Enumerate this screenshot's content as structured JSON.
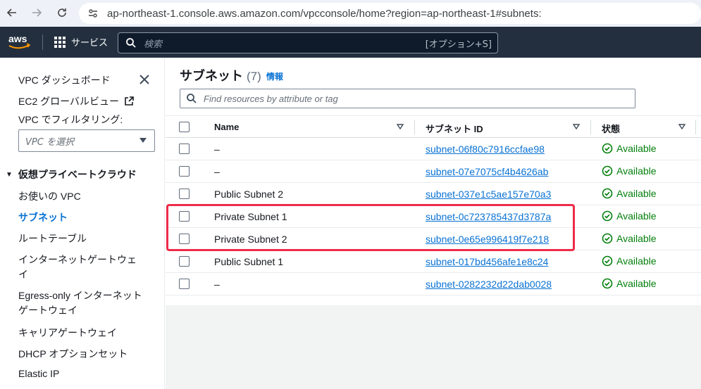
{
  "browser": {
    "url": "ap-northeast-1.console.aws.amazon.com/vpcconsole/home?region=ap-northeast-1#subnets:"
  },
  "aws_nav": {
    "logo_text": "aws",
    "services_label": "サービス",
    "search_placeholder": "検索",
    "search_shortcut": "[オプション+S]"
  },
  "sidebar": {
    "dashboard": "VPC ダッシュボード",
    "ec2_global_view": "EC2 グローバルビュー",
    "filter_label": "VPC でフィルタリング:",
    "vpc_select_placeholder": "VPC を選択",
    "section_title": "仮想プライベートクラウド",
    "items": [
      {
        "label": "お使いの VPC",
        "active": false
      },
      {
        "label": "サブネット",
        "active": true
      },
      {
        "label": "ルートテーブル",
        "active": false
      },
      {
        "label": "インターネットゲートウェ",
        "label2": "イ",
        "active": false
      },
      {
        "label": "Egress-only インターネット",
        "label2": "ゲートウェイ",
        "active": false
      },
      {
        "label": "キャリアゲートウェイ",
        "active": false
      },
      {
        "label": "DHCP オプションセット",
        "active": false
      },
      {
        "label": "Elastic IP",
        "active": false
      }
    ]
  },
  "main": {
    "title": "サブネット",
    "count": "(7)",
    "info": "情報",
    "filter_placeholder": "Find resources by attribute or tag",
    "columns": {
      "name": "Name",
      "subnet_id": "サブネット ID",
      "state": "状態"
    },
    "rows": [
      {
        "name": "–",
        "subnet_id": "subnet-06f80c7916ccfae98",
        "state": "Available"
      },
      {
        "name": "–",
        "subnet_id": "subnet-07e7075cf4b4626ab",
        "state": "Available"
      },
      {
        "name": "Public Subnet 2",
        "subnet_id": "subnet-037e1c5ae157e70a3",
        "state": "Available"
      },
      {
        "name": "Private Subnet 1",
        "subnet_id": "subnet-0c723785437d3787a",
        "state": "Available"
      },
      {
        "name": "Private Subnet 2",
        "subnet_id": "subnet-0e65e996419f7e218",
        "state": "Available"
      },
      {
        "name": "Public Subnet 1",
        "subnet_id": "subnet-017bd456afe1e8c24",
        "state": "Available"
      },
      {
        "name": "–",
        "subnet_id": "subnet-0282232d22dab0028",
        "state": "Available"
      }
    ]
  },
  "colors": {
    "aws_nav_bg": "#232f3e",
    "link_blue": "#0972d3",
    "available_green": "#037f0c",
    "highlight_red": "#ee2b4a"
  },
  "icons": {
    "back": "arrow-left-icon",
    "forward": "arrow-right-icon",
    "reload": "reload-icon",
    "site_info": "tune-icon",
    "services": "grid-icon",
    "search": "search-icon",
    "close": "close-icon",
    "external": "external-link-icon",
    "sort": "sort-caret-icon",
    "status": "check-circle-icon"
  }
}
